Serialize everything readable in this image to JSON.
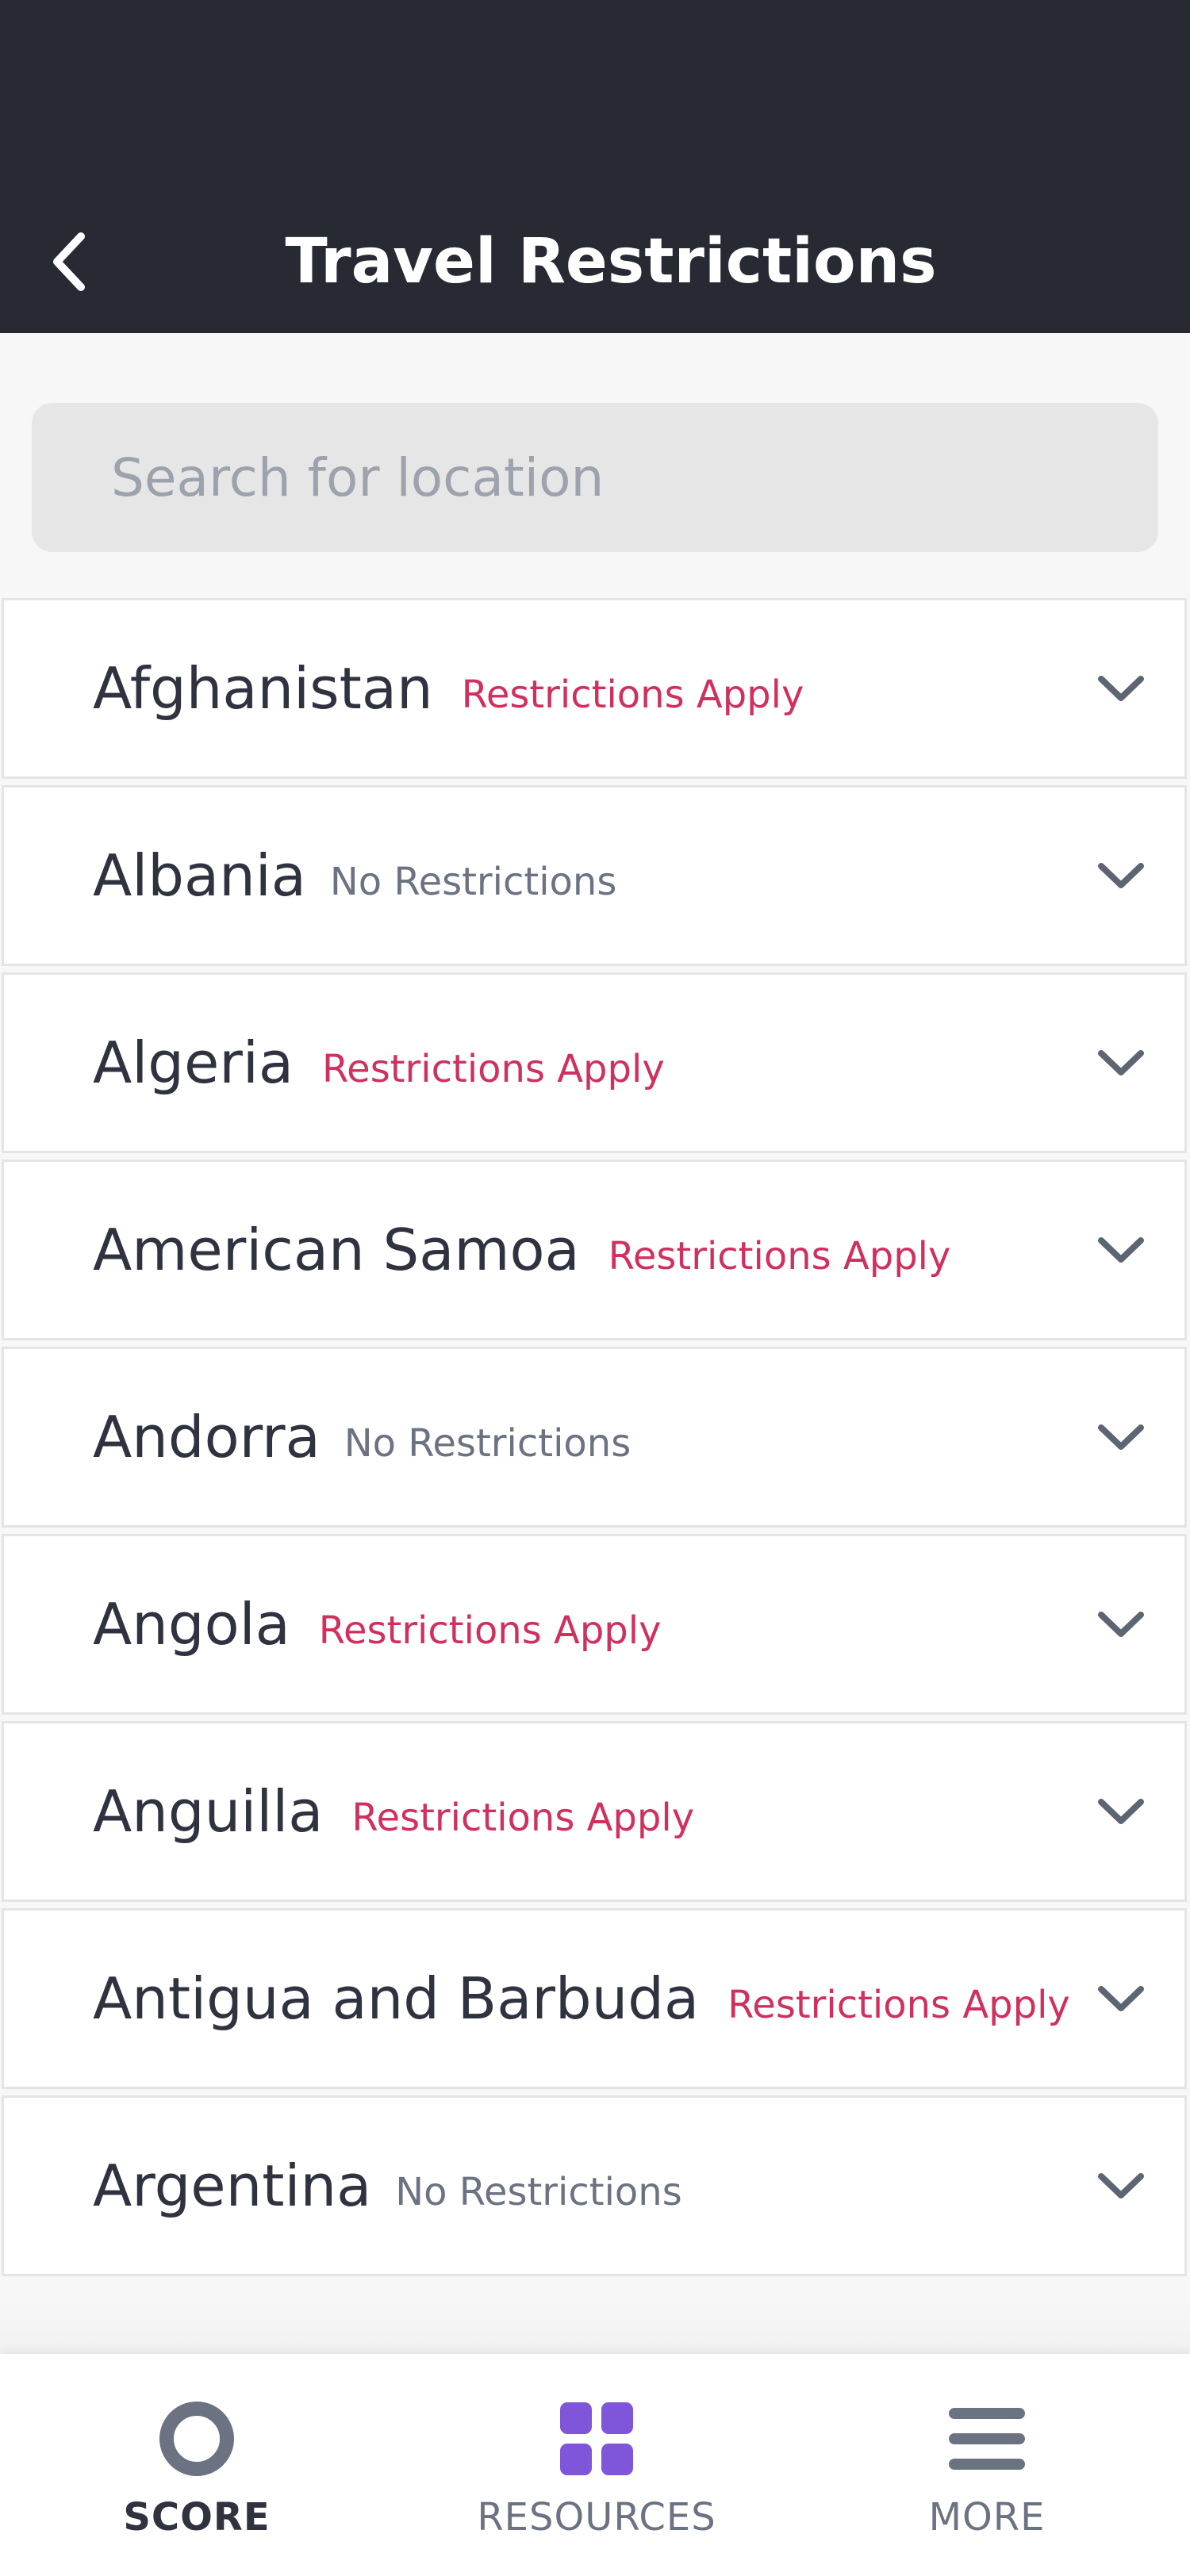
{
  "header": {
    "title": "Travel Restrictions"
  },
  "search": {
    "placeholder": "Search for location",
    "value": ""
  },
  "colors": {
    "header_bg": "#272a33",
    "restricted": "#d0305e",
    "no_restrictions": "#6b7382",
    "resources_icon": "#7f56d9"
  },
  "countries": [
    {
      "name": "Afghanistan",
      "status": "Restrictions Apply",
      "restricted": true
    },
    {
      "name": "Albania",
      "status": "No Restrictions",
      "restricted": false
    },
    {
      "name": "Algeria",
      "status": "Restrictions Apply",
      "restricted": true
    },
    {
      "name": "American Samoa",
      "status": "Restrictions Apply",
      "restricted": true
    },
    {
      "name": "Andorra",
      "status": "No Restrictions",
      "restricted": false
    },
    {
      "name": "Angola",
      "status": "Restrictions Apply",
      "restricted": true
    },
    {
      "name": "Anguilla",
      "status": "Restrictions Apply",
      "restricted": true
    },
    {
      "name": "Antigua and Barbuda",
      "status": "Restrictions Apply",
      "restricted": true
    },
    {
      "name": "Argentina",
      "status": "No Restrictions",
      "restricted": false
    }
  ],
  "tabbar": {
    "active": "score",
    "tabs": [
      {
        "id": "score",
        "label": "SCORE",
        "icon": "ring-icon"
      },
      {
        "id": "resources",
        "label": "RESOURCES",
        "icon": "grid-icon"
      },
      {
        "id": "more",
        "label": "MORE",
        "icon": "menu-icon"
      }
    ]
  }
}
